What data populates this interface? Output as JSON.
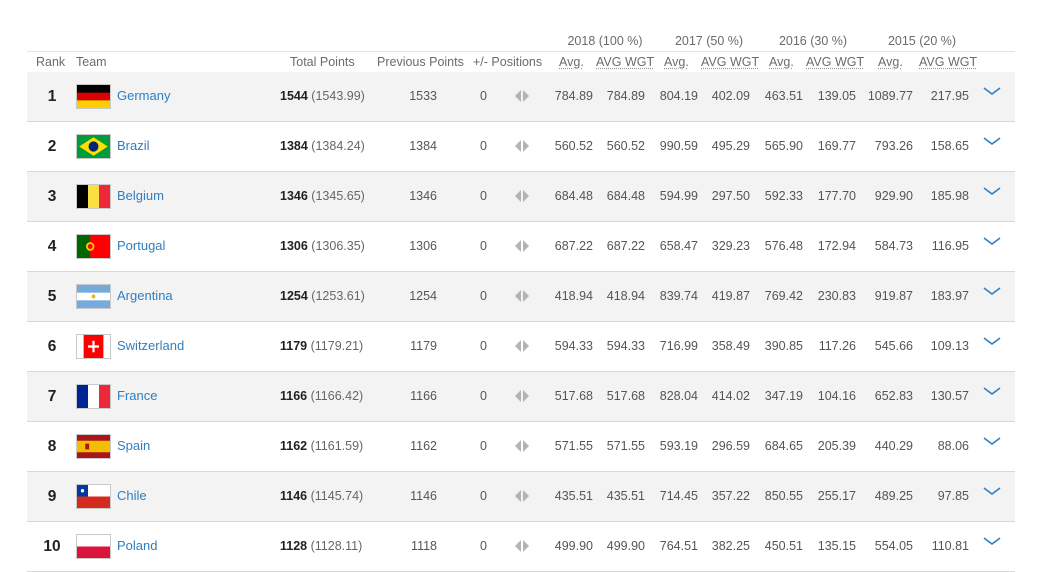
{
  "header": {
    "years": [
      "2018 (100 %)",
      "2017 (50 %)",
      "2016 (30 %)",
      "2015 (20 %)"
    ],
    "rank": "Rank",
    "team": "Team",
    "total_points": "Total Points",
    "previous_points": "Previous Points",
    "positions": "+/- Positions",
    "avg": "Avg.",
    "avg_wgt": "AVG WGT"
  },
  "rows": [
    {
      "rank": "1",
      "team": "Germany",
      "flag": "de",
      "points": "1544",
      "points_exact": "(1543.99)",
      "prev": "1533",
      "change": "0",
      "values": [
        "784.89",
        "784.89",
        "804.19",
        "402.09",
        "463.51",
        "139.05",
        "1089.77",
        "217.95"
      ]
    },
    {
      "rank": "2",
      "team": "Brazil",
      "flag": "br",
      "points": "1384",
      "points_exact": "(1384.24)",
      "prev": "1384",
      "change": "0",
      "values": [
        "560.52",
        "560.52",
        "990.59",
        "495.29",
        "565.90",
        "169.77",
        "793.26",
        "158.65"
      ]
    },
    {
      "rank": "3",
      "team": "Belgium",
      "flag": "be",
      "points": "1346",
      "points_exact": "(1345.65)",
      "prev": "1346",
      "change": "0",
      "values": [
        "684.48",
        "684.48",
        "594.99",
        "297.50",
        "592.33",
        "177.70",
        "929.90",
        "185.98"
      ]
    },
    {
      "rank": "4",
      "team": "Portugal",
      "flag": "pt",
      "points": "1306",
      "points_exact": "(1306.35)",
      "prev": "1306",
      "change": "0",
      "values": [
        "687.22",
        "687.22",
        "658.47",
        "329.23",
        "576.48",
        "172.94",
        "584.73",
        "116.95"
      ]
    },
    {
      "rank": "5",
      "team": "Argentina",
      "flag": "ar",
      "points": "1254",
      "points_exact": "(1253.61)",
      "prev": "1254",
      "change": "0",
      "values": [
        "418.94",
        "418.94",
        "839.74",
        "419.87",
        "769.42",
        "230.83",
        "919.87",
        "183.97"
      ]
    },
    {
      "rank": "6",
      "team": "Switzerland",
      "flag": "ch",
      "points": "1179",
      "points_exact": "(1179.21)",
      "prev": "1179",
      "change": "0",
      "values": [
        "594.33",
        "594.33",
        "716.99",
        "358.49",
        "390.85",
        "117.26",
        "545.66",
        "109.13"
      ]
    },
    {
      "rank": "7",
      "team": "France",
      "flag": "fr",
      "points": "1166",
      "points_exact": "(1166.42)",
      "prev": "1166",
      "change": "0",
      "values": [
        "517.68",
        "517.68",
        "828.04",
        "414.02",
        "347.19",
        "104.16",
        "652.83",
        "130.57"
      ]
    },
    {
      "rank": "8",
      "team": "Spain",
      "flag": "es",
      "points": "1162",
      "points_exact": "(1161.59)",
      "prev": "1162",
      "change": "0",
      "values": [
        "571.55",
        "571.55",
        "593.19",
        "296.59",
        "684.65",
        "205.39",
        "440.29",
        "88.06"
      ]
    },
    {
      "rank": "9",
      "team": "Chile",
      "flag": "cl",
      "points": "1146",
      "points_exact": "(1145.74)",
      "prev": "1146",
      "change": "0",
      "values": [
        "435.51",
        "435.51",
        "714.45",
        "357.22",
        "850.55",
        "255.17",
        "489.25",
        "97.85"
      ]
    },
    {
      "rank": "10",
      "team": "Poland",
      "flag": "pl",
      "points": "1128",
      "points_exact": "(1128.11)",
      "prev": "1118",
      "change": "0",
      "values": [
        "499.90",
        "499.90",
        "764.51",
        "382.25",
        "450.51",
        "135.15",
        "554.05",
        "110.81"
      ]
    }
  ],
  "colors": {
    "link": "#2f7ec1",
    "stripe": "#f3f3f3",
    "border": "#d9d9d9"
  },
  "icons": {
    "positions": "left-right-arrows-icon",
    "expand": "chevron-down-icon"
  }
}
